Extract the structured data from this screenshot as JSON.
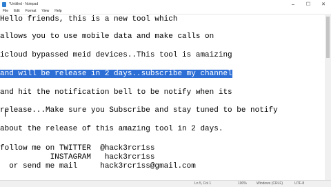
{
  "window": {
    "title": "*Untitled - Notepad",
    "minimize": "–",
    "maximize": "☐",
    "close": "✕"
  },
  "menu": [
    "File",
    "Edit",
    "Format",
    "View",
    "Help"
  ],
  "document": {
    "lines": [
      "Hello friends, this is a new tool which",
      "allows you to use mobile data and make calls on",
      "icloud bypassed meid devices..This tool is amaizing",
      "and will be release in 2 days..subscribe my channel",
      "and hit the notification bell to be notify when its",
      "release...Make sure you Subscribe and stay tuned to be notify",
      "about the release of this amazing tool in 2 days.",
      "follow me on TWITTER  @hack3rcr1ss",
      "           INSTAGRAM   hack3rcr1ss",
      "  or send me mail     hack3rcr1ss@gmail.com"
    ],
    "selected_line_index": 3
  },
  "statusbar": {
    "position": "Ln 5, Col 1",
    "zoom": "100%",
    "line_ending": "Windows (CRLF)",
    "encoding": "UTF-8"
  }
}
